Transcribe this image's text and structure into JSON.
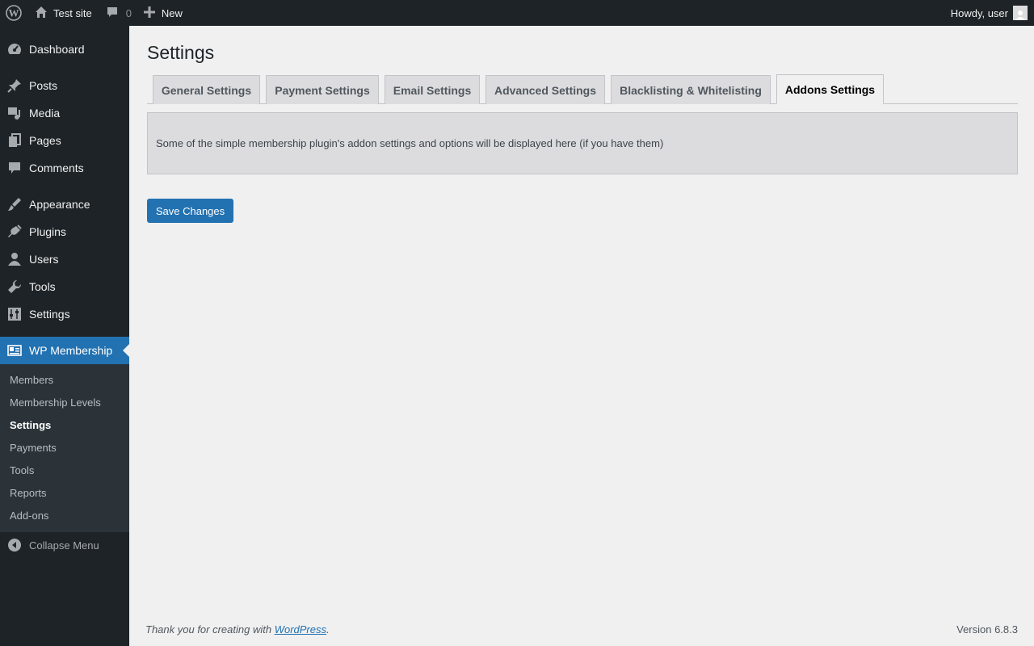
{
  "adminbar": {
    "site_name": "Test site",
    "comments_count": "0",
    "new_label": "New",
    "howdy": "Howdy, user"
  },
  "sidebar": {
    "items": [
      {
        "label": "Dashboard",
        "icon": "dashboard-icon"
      },
      {
        "label": "Posts",
        "icon": "pin-icon"
      },
      {
        "label": "Media",
        "icon": "media-icon"
      },
      {
        "label": "Pages",
        "icon": "pages-icon"
      },
      {
        "label": "Comments",
        "icon": "comment-icon"
      },
      {
        "label": "Appearance",
        "icon": "brush-icon"
      },
      {
        "label": "Plugins",
        "icon": "plugin-icon"
      },
      {
        "label": "Users",
        "icon": "user-icon"
      },
      {
        "label": "Tools",
        "icon": "wrench-icon"
      },
      {
        "label": "Settings",
        "icon": "settings-icon"
      },
      {
        "label": "WP Membership",
        "icon": "id-card-icon",
        "active": true
      }
    ],
    "submenu": [
      "Members",
      "Membership Levels",
      "Settings",
      "Payments",
      "Tools",
      "Reports",
      "Add-ons"
    ],
    "submenu_current": "Settings",
    "collapse_label": "Collapse Menu"
  },
  "main": {
    "title": "Settings",
    "tabs": [
      {
        "label": "General Settings"
      },
      {
        "label": "Payment Settings"
      },
      {
        "label": "Email Settings"
      },
      {
        "label": "Advanced Settings"
      },
      {
        "label": "Blacklisting & Whitelisting"
      },
      {
        "label": "Addons Settings",
        "active": true
      }
    ],
    "notice": "Some of the simple membership plugin's addon settings and options will be displayed here (if you have them)",
    "save_label": "Save Changes"
  },
  "footer": {
    "thanks_prefix": "Thank you for creating with ",
    "thanks_link": "WordPress",
    "thanks_suffix": ".",
    "version": "Version 6.8.3"
  },
  "colors": {
    "accent": "#2271b1",
    "admin_dark": "#1d2327",
    "submenu_bg": "#2c3338",
    "page_bg": "#f0f0f1"
  }
}
